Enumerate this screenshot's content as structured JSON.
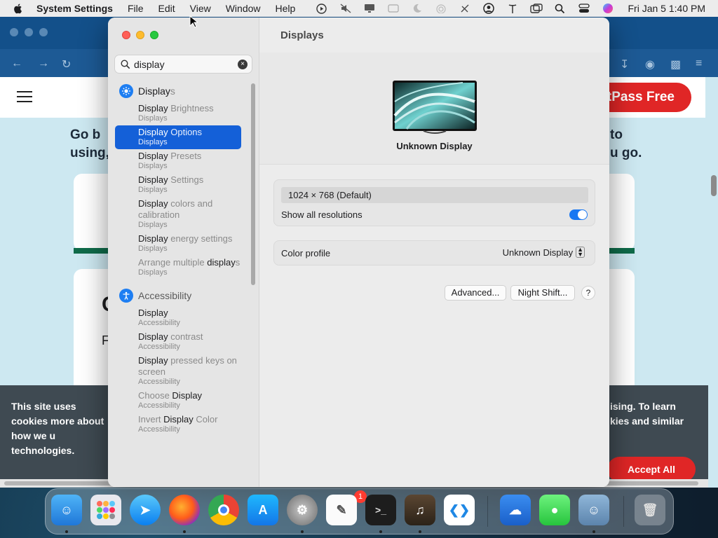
{
  "menubar": {
    "app_name": "System Settings",
    "menus": [
      "File",
      "Edit",
      "View",
      "Window",
      "Help"
    ],
    "status_icons": [
      "play-circle-icon",
      "mute-icon",
      "display-icon",
      "tablet-icon",
      "moon-icon",
      "airdrop-icon",
      "no-wifi-icon",
      "user-icon",
      "antenna-icon",
      "window-icon",
      "search-icon",
      "control-center-icon",
      "siri-icon"
    ],
    "clock": "Fri Jan 5  1:40 PM"
  },
  "browser": {
    "cta": "tPass Free",
    "text_left_1": "Go b",
    "text_left_2": "using,",
    "text_right_1": "to",
    "text_right_2": "u go.",
    "card_letter_1": "",
    "card_letter_2": "C",
    "card_letter_3": "F",
    "cookie_left": "This site uses cookies more about how we u technologies.",
    "cookie_right": "ising. To learn kies and similar",
    "accept": "Accept All"
  },
  "settings": {
    "search": {
      "value": "display",
      "placeholder": "Search"
    },
    "sections": [
      {
        "name_match": "Display",
        "name_rest": "s",
        "icon": "displays-icon",
        "items": [
          {
            "match": "Display",
            "rest": " Brightness",
            "sub": "Displays"
          },
          {
            "match": "Display",
            "rest": " Options",
            "sub": "Displays",
            "selected": true
          },
          {
            "match": "Display",
            "rest": " Presets",
            "sub": "Displays"
          },
          {
            "match": "Display",
            "rest": " Settings",
            "sub": "Displays"
          },
          {
            "match": "Display",
            "rest": " colors and calibration",
            "sub": "Displays"
          },
          {
            "match": "Display",
            "rest": " energy settings",
            "sub": "Displays"
          },
          {
            "pre": "Arrange multiple ",
            "match": "display",
            "rest": "s",
            "sub": "Displays"
          }
        ]
      },
      {
        "name_match": "",
        "name_rest": "Accessibility",
        "icon": "accessibility-icon",
        "items": [
          {
            "match": "Display",
            "rest": "",
            "sub": "Accessibility"
          },
          {
            "match": "Display",
            "rest": " contrast",
            "sub": "Accessibility"
          },
          {
            "match": "Display",
            "rest": " pressed keys on screen",
            "sub": "Accessibility"
          },
          {
            "pre": "Choose ",
            "match": "Display",
            "rest": "",
            "sub": "Accessibility"
          },
          {
            "pre": "Invert ",
            "match": "Display",
            "rest": " Color",
            "sub": "Accessibility"
          }
        ]
      }
    ],
    "main": {
      "title": "Displays",
      "display_name": "Unknown Display",
      "resolution": "1024 × 768 (Default)",
      "show_all_label": "Show all resolutions",
      "show_all_on": true,
      "color_profile_label": "Color profile",
      "color_profile_value": "Unknown Display",
      "advanced": "Advanced...",
      "night_shift": "Night Shift...",
      "help": "?"
    }
  },
  "dock": {
    "apps": [
      "finder-icon",
      "launchpad-icon",
      "safari-icon",
      "firefox-icon",
      "chrome-icon",
      "app-store-icon",
      "system-settings-icon",
      "textedit-icon",
      "terminal-icon",
      "garageband-icon",
      "vscode-icon",
      "weather-icon",
      "messages-icon",
      "finder-2-icon",
      "trash-icon"
    ],
    "settings_badge": "1"
  },
  "colors": {
    "accent": "#1460d8",
    "toggle": "#1877f2",
    "red_cta": "#e02626"
  }
}
